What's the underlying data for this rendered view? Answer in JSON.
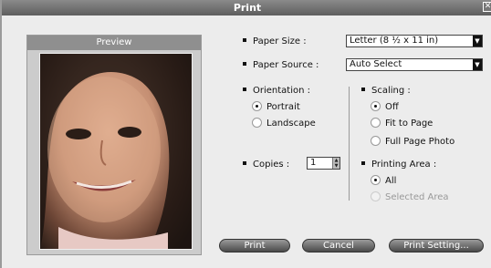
{
  "window": {
    "title": "Print"
  },
  "preview": {
    "title": "Preview"
  },
  "paper_size": {
    "label": "Paper Size :",
    "value": "Letter (8 ½ x 11 in)"
  },
  "paper_source": {
    "label": "Paper Source :",
    "value": "Auto Select"
  },
  "orientation": {
    "label": "Orientation :",
    "options": [
      {
        "label": "Portrait",
        "checked": true
      },
      {
        "label": "Landscape",
        "checked": false
      }
    ]
  },
  "copies": {
    "label": "Copies :",
    "value": "1"
  },
  "scaling": {
    "label": "Scaling :",
    "options": [
      {
        "label": "Off",
        "checked": true
      },
      {
        "label": "Fit to Page",
        "checked": false
      },
      {
        "label": "Full Page Photo",
        "checked": false
      }
    ]
  },
  "printing_area": {
    "label": "Printing Area :",
    "options": [
      {
        "label": "All",
        "checked": true
      },
      {
        "label": "Selected Area",
        "checked": false,
        "disabled": true
      }
    ]
  },
  "buttons": {
    "print": "Print",
    "cancel": "Cancel",
    "print_setting": "Print Setting..."
  }
}
